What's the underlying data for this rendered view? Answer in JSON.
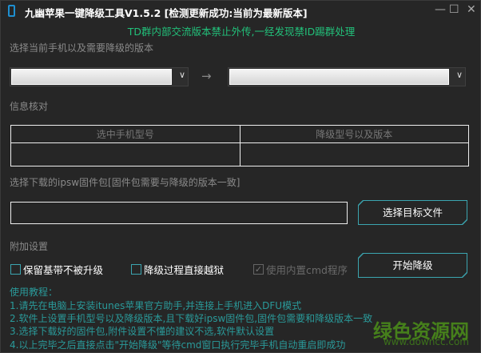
{
  "window": {
    "title": "九幽苹果一键降级工具V1.5.2 [检测更新成功:当前为最新版本]",
    "minimize": "—",
    "maximize": "☐",
    "close": "✕"
  },
  "notice": "TD群内部交流版本禁止外传,一经发现禁ID踢群处理",
  "version_section": {
    "label": "选择当前手机以及需要降级的版本",
    "arrow": "→",
    "dropdown_glyph": "∨"
  },
  "info_section": {
    "label": "信息核对",
    "headers": [
      "选中手机型号",
      "降级型号以及版本"
    ],
    "values": [
      "",
      ""
    ]
  },
  "ipsw_section": {
    "label": "选择下载的ipsw固件包[固件包需要与降级的版本一致]",
    "path_value": "",
    "select_button": "选择目标文件"
  },
  "extra_section": {
    "label": "附加设置",
    "options": [
      {
        "label": "保留基带不被升级",
        "checked": false,
        "enabled": true
      },
      {
        "label": "降级过程直接越狱",
        "checked": false,
        "enabled": true
      },
      {
        "label": "使用内置cmd程序",
        "checked": true,
        "enabled": false
      }
    ],
    "start_button": "开始降级"
  },
  "tutorial": [
    "使用教程：",
    "1.请先在电脑上安装itunes苹果官方助手,并连接上手机进入DFU模式",
    "2.软件上设置手机型号以及降级版本,且下载好ipsw固件包,固件包需要和降级版本一致",
    "3.选择下载好的固件包,附件设置不懂的建议不选,软件默认设置",
    "4.以上完毕之后直接点击\"开始降级\"等待cmd窗口执行完毕手机自动重启即成功"
  ],
  "watermark": {
    "name": "绿色资源网",
    "url": "www.downcc.com"
  },
  "colors": {
    "accent": "#3ba5b0",
    "notice": "#22c07a",
    "tutorial": "#2a9a9a",
    "background": "#262626"
  }
}
